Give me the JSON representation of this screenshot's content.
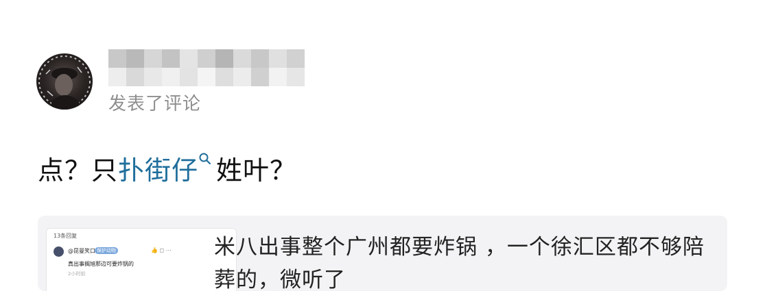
{
  "post": {
    "action_text": "发表了评论"
  },
  "comment": {
    "prefix": "点？只",
    "keyword": "扑街仔",
    "suffix": "姓叶？"
  },
  "quoted": {
    "reply_count": "13条回复",
    "user_name": "@昆曼笑口",
    "badge": "保护动物",
    "reply_text": "真出事搁旭那边可要炸锅的",
    "reply_time": "2小时前",
    "text": "米八出事整个广州都要炸锅 ，一个徐汇区都不够陪葬的，微听了"
  },
  "colors": {
    "keyword": "#1f6e9c",
    "action_gray": "#8e8e8e",
    "card_bg": "#f3f3f5"
  },
  "icons": {
    "keyword_search": "search-icon",
    "like": "thumbs-up-icon",
    "reply": "reply-icon",
    "more": "more-icon"
  }
}
